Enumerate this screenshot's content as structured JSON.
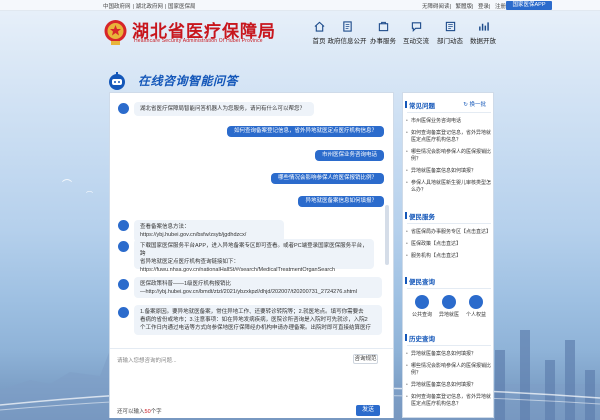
{
  "topbar": {
    "links": [
      "中国政府网",
      "湖北政府网",
      "国家医保局"
    ],
    "right_links": [
      "无障碍阅读",
      "繁體版",
      "登录",
      "注册"
    ],
    "button": "国家医保APP"
  },
  "header": {
    "title": "湖北省医疗保障局",
    "subtitle": "Healthcare Security Administration Of Hubei Province",
    "nav": [
      {
        "label": "首页",
        "icon": "home-icon"
      },
      {
        "label": "政府信息公开",
        "icon": "document-icon"
      },
      {
        "label": "办事服务",
        "icon": "service-icon"
      },
      {
        "label": "互动交流",
        "icon": "chat-icon"
      },
      {
        "label": "部门动态",
        "icon": "news-icon"
      },
      {
        "label": "数据开放",
        "icon": "data-icon"
      }
    ]
  },
  "banner": {
    "title": "在线咨询智能问答"
  },
  "chat": {
    "welcome": "湖北省医疗保障局智能问答机器人为您服务，请问有什么可以帮您？",
    "user_questions": [
      "如何查询备案登记信息，省外异地就医定点医疗机构信息？",
      "市州医保业务咨询电话",
      "哪些情况会影响参保人的医保报销比例？",
      "异地就医备案信息如何填报？"
    ],
    "answer1": "查看备案信息方法：https://ybj.hubei.gov.cn/bsfw/zsyb/jgdhdzcx/",
    "answer2": [
      "下载国家医保服务平台APP，进入异地备案专区即可查看。或者PC端登录国家医保服务平台，跨",
      "省异地就医定点医疗机构查询链接如下：",
      "https://fuwu.nhsa.gov.cn/nationalHallSt/#/search/MedicalTreatmentOrganSearch"
    ],
    "answer3": [
      "医保政策科普——1级医疗机构报销比",
      "—http://ybj.hubei.gov.cn/bmdt/ztzl/2021/ybzxkpzl/dhjd/202007/t20200731_2724276.shtml"
    ],
    "answer4": [
      "1.备案原因。要异地就医备案，常住异地工作、还要转诊转院等；2.就医地点。填写你需要去",
      "看病的省份或地市；3.注意事项：如在异地发病疾病，医院诊所咨询是入院时可先就诊，入院2",
      "个工作日内通过电话等方式向参保地医疗保障经办机构申请办理备案。出院时即可直接结算医疗"
    ],
    "input_placeholder": "请输入您想咨询的问题...",
    "norm_button": "咨询规范",
    "count_prefix": "还可以输入",
    "count_value": "50",
    "count_suffix": "个字",
    "send_button": "发送"
  },
  "side": {
    "common_title": "常见问题",
    "refresh": "换一批",
    "common_items": [
      "市州医保业务咨询电话",
      "如何查询备案登记信息，省外异地就医定点医疗机构信息？",
      "哪些情况会影响参保人的医保报销比例？",
      "异地就医备案信息如何填报？",
      "参保人具地就医新生婴儿审核类型怎么办？"
    ],
    "service_title": "便民服务",
    "service_items": [
      "省医保局办事服务专区【点击直达】",
      "医保政策【点击直达】",
      "服务机构【点击直达】"
    ],
    "query_title": "便民查询",
    "quick": [
      "公共查询",
      "异地就医",
      "个人权益"
    ],
    "history_title": "历史查询",
    "history_items": [
      "异地就医备案信息如何填报？",
      "哪些情况会影响参保人的医保报销比例？",
      "异地就医备案信息如何填报？",
      "如何查询备案登记信息，省外异地就医定点医疗机构信息？"
    ]
  }
}
